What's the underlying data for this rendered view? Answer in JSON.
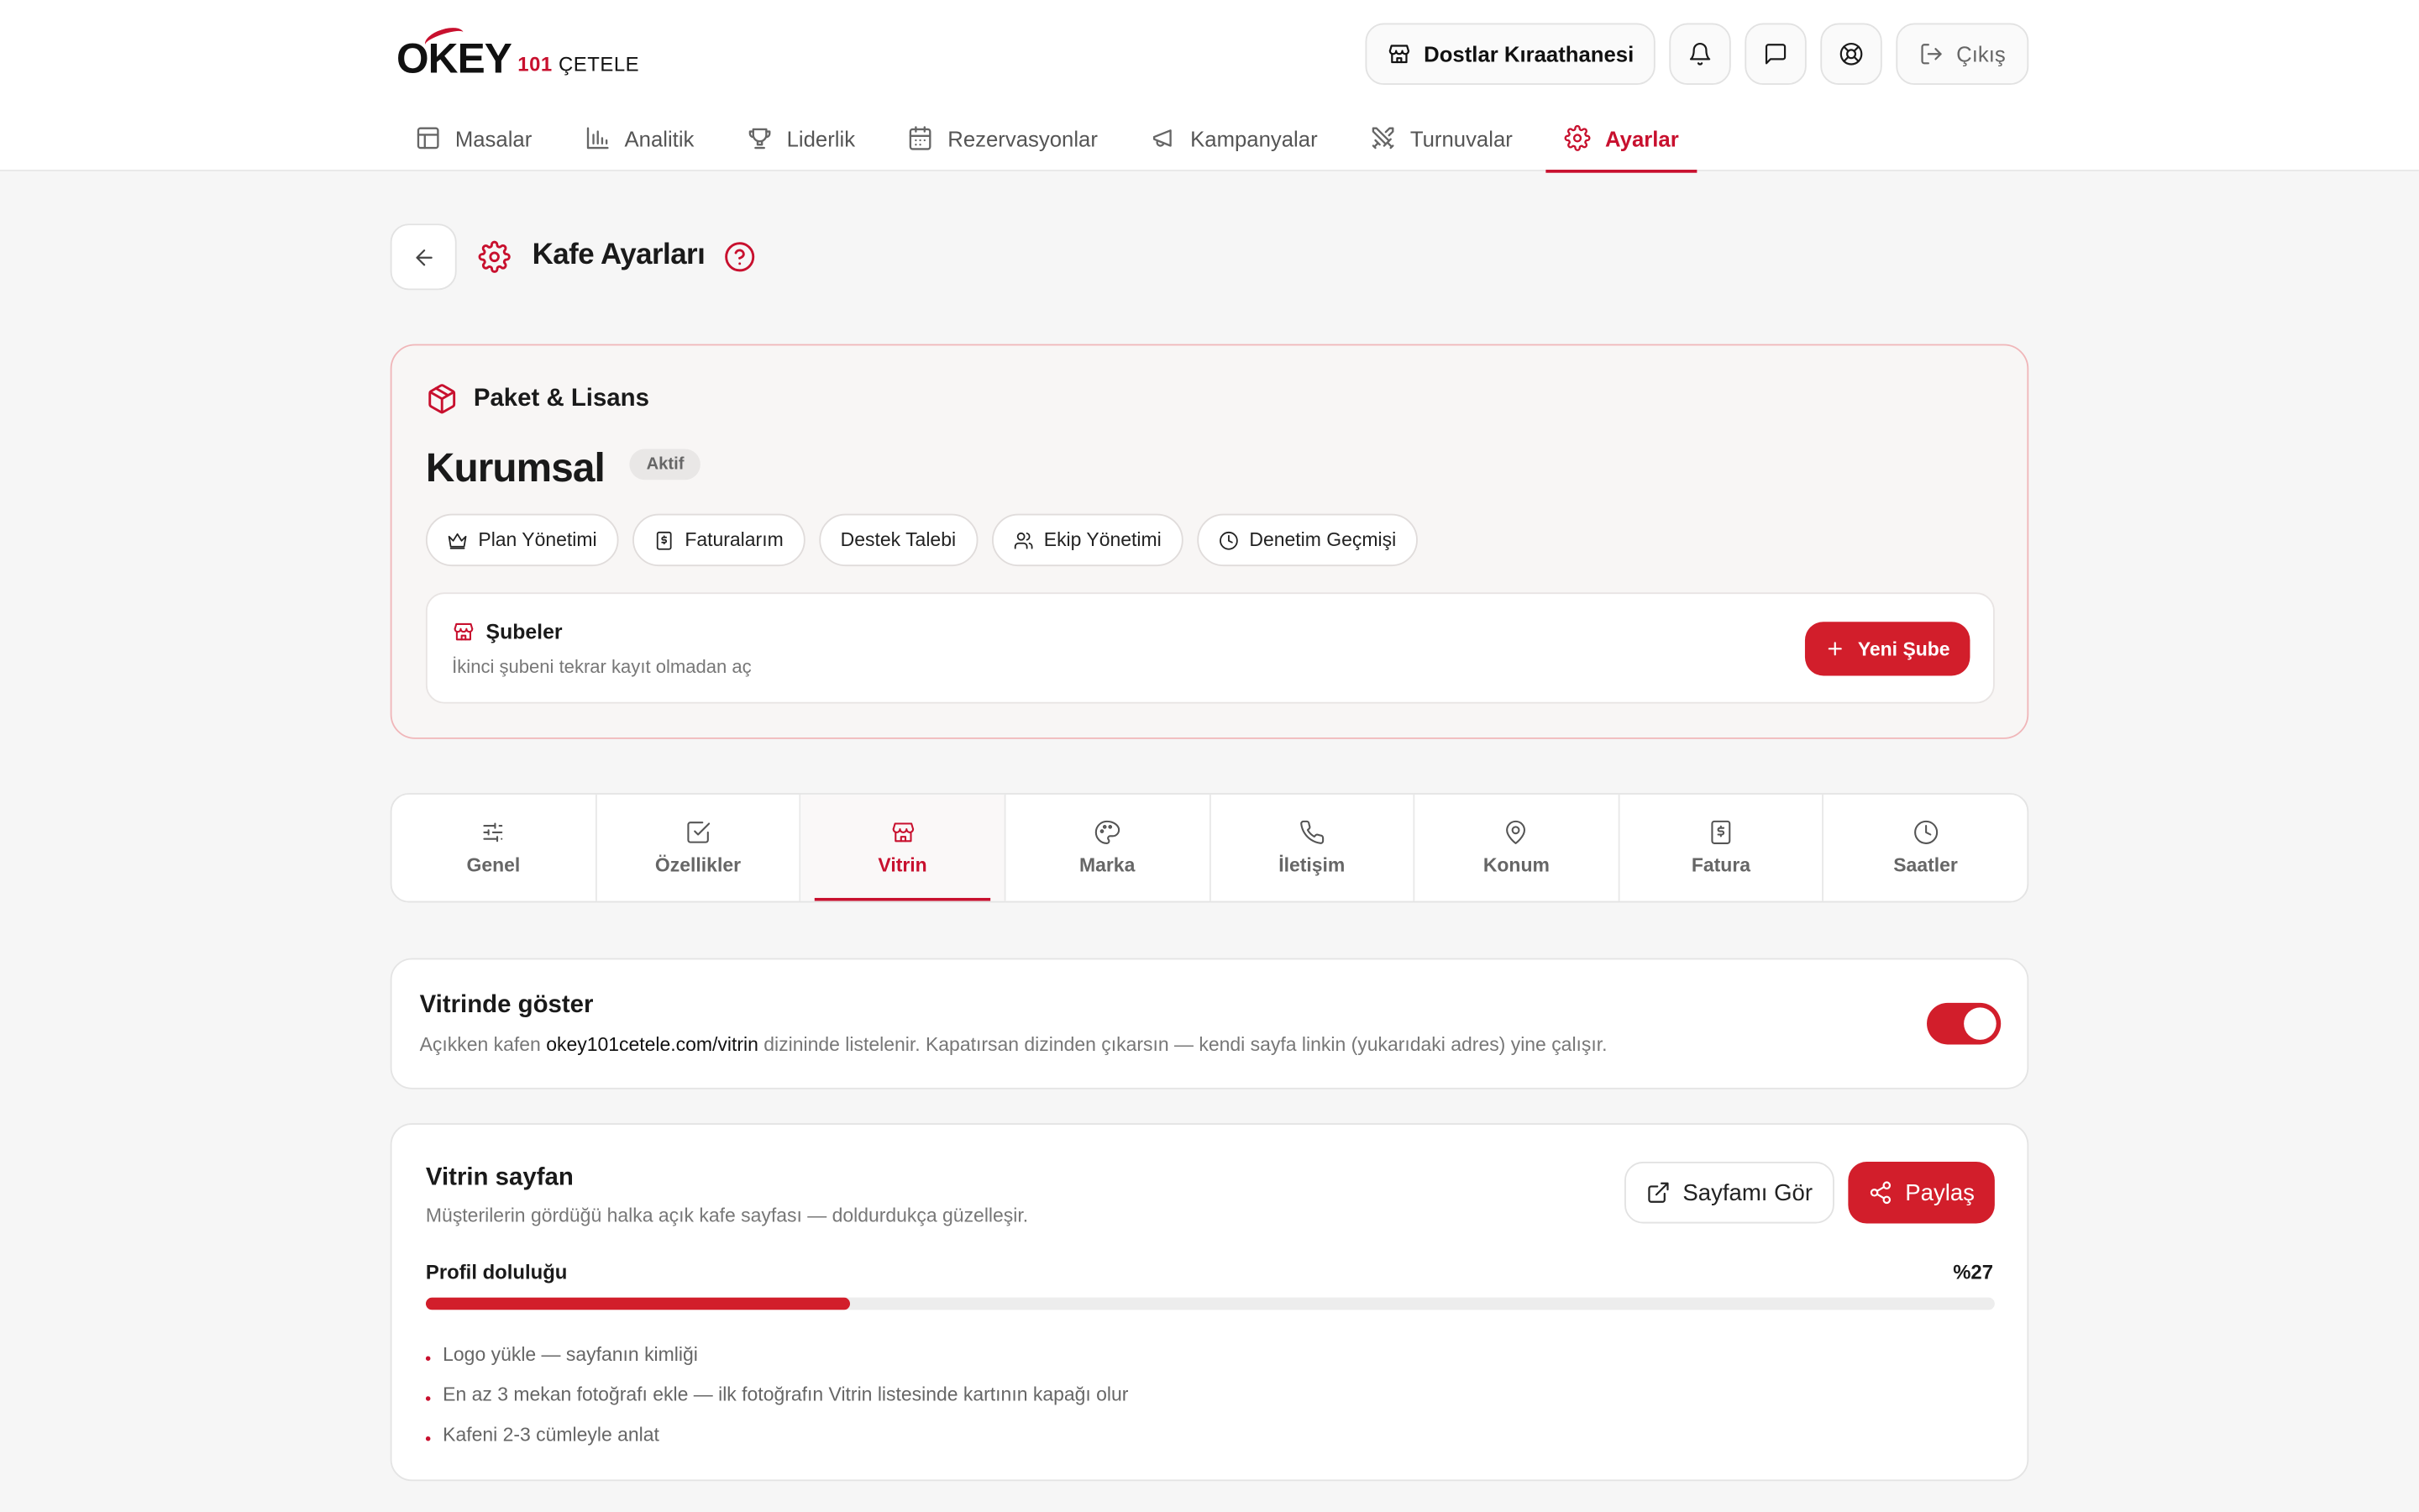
{
  "logo": {
    "brand": "OKEY",
    "num": "101",
    "sub": "ÇETELE"
  },
  "header": {
    "cafe_name": "Dostlar Kıraathanesi",
    "logout_label": "Çıkış"
  },
  "nav": {
    "items": [
      {
        "label": "Masalar",
        "icon": "table-icon"
      },
      {
        "label": "Analitik",
        "icon": "chart-icon"
      },
      {
        "label": "Liderlik",
        "icon": "trophy-icon"
      },
      {
        "label": "Rezervasyonlar",
        "icon": "calendar-icon"
      },
      {
        "label": "Kampanyalar",
        "icon": "megaphone-icon"
      },
      {
        "label": "Turnuvalar",
        "icon": "swords-icon"
      },
      {
        "label": "Ayarlar",
        "icon": "gear-icon"
      }
    ],
    "active": "Ayarlar"
  },
  "page": {
    "title": "Kafe Ayarları"
  },
  "license": {
    "section_title": "Paket & Lisans",
    "plan": "Kurumsal",
    "status": "Aktif",
    "actions": [
      "Plan Yönetimi",
      "Faturalarım",
      "Destek Talebi",
      "Ekip Yönetimi",
      "Denetim Geçmişi"
    ],
    "branches": {
      "title": "Şubeler",
      "desc": "İkinci şubeni tekrar kayıt olmadan aç",
      "button": "Yeni Şube"
    }
  },
  "tabs": {
    "items": [
      "Genel",
      "Özellikler",
      "Vitrin",
      "Marka",
      "İletişim",
      "Konum",
      "Fatura",
      "Saatler"
    ],
    "active": "Vitrin"
  },
  "showcase": {
    "title": "Vitrinde göster",
    "desc_pre": "Açıkken kafen ",
    "desc_link": "okey101cetele.com/vitrin",
    "desc_post": " dizininde listelenir. Kapatırsan dizinden çıkarsın — kendi sayfa linkin (yukarıdaki adres) yine çalışır.",
    "enabled": true
  },
  "vitrin_page": {
    "title": "Vitrin sayfan",
    "desc": "Müşterilerin gördüğü halka açık kafe sayfası — doldurdukça güzelleşir.",
    "view_button": "Sayfamı Gör",
    "share_button": "Paylaş",
    "progress_label": "Profil doluluğu",
    "progress_text": "%27",
    "progress_percent": 27,
    "tips": [
      "Logo yükle — sayfanın kimliği",
      "En az 3 mekan fotoğrafı ekle — ilk fotoğrafın Vitrin listesinde kartının kapağı olur",
      "Kafeni 2-3 cümleyle anlat"
    ]
  },
  "colors": {
    "accent": "#d21e2b",
    "border_accent": "#f0b6b9"
  }
}
